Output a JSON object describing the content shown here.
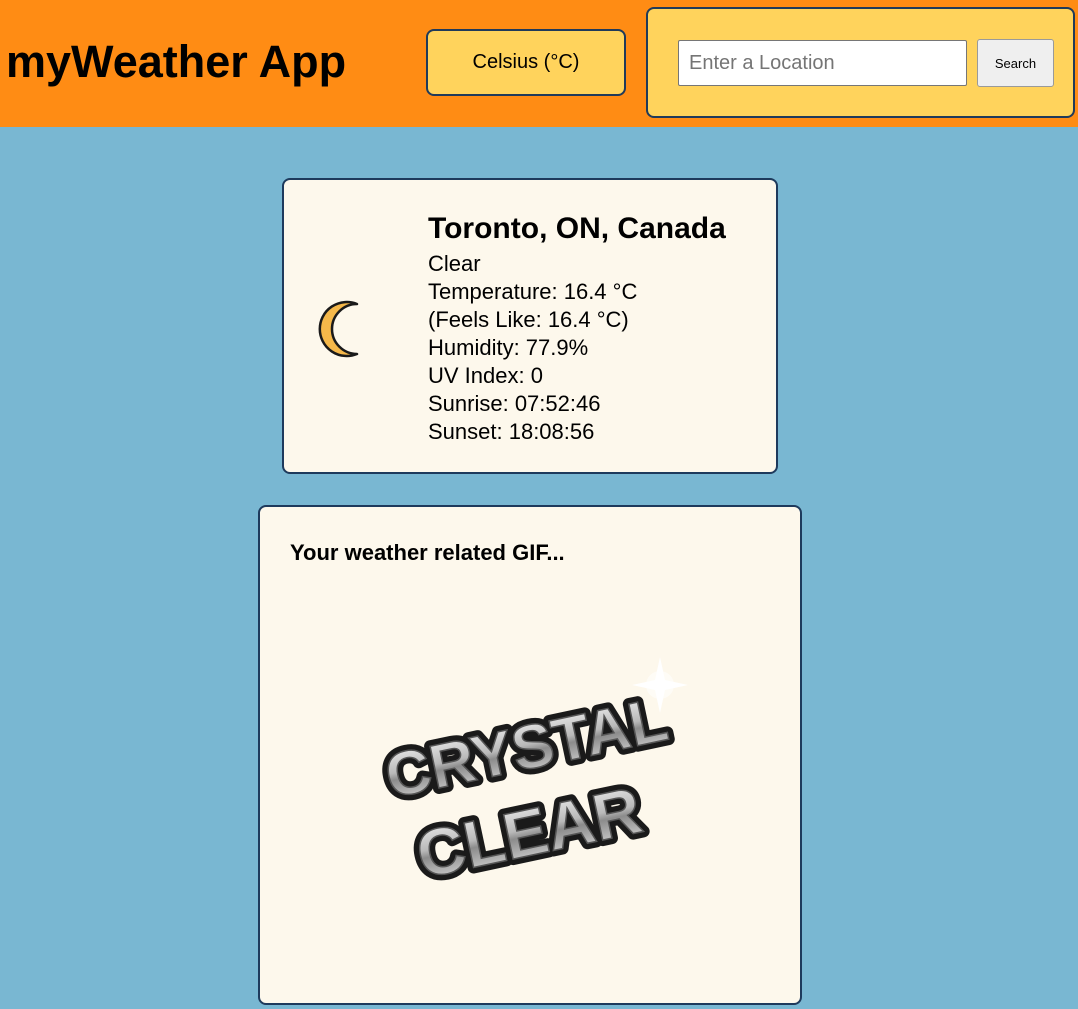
{
  "header": {
    "app_title": "myWeather App",
    "unit_toggle_label": "Celsius (°C)",
    "search": {
      "placeholder": "Enter a Location",
      "value": "",
      "button_label": "Search"
    }
  },
  "weather": {
    "icon": "moon-icon",
    "location": "Toronto, ON, Canada",
    "condition": "Clear",
    "temperature": "Temperature: 16.4 °C",
    "feels_like": "(Feels Like: 16.4 °C)",
    "humidity": "Humidity: 77.9%",
    "uv_index": "UV Index: 0",
    "sunrise": "Sunrise: 07:52:46",
    "sunset": "Sunset: 18:08:56"
  },
  "gif_section": {
    "heading": "Your weather related GIF...",
    "gif_text_line1": "CRYSTAL",
    "gif_text_line2": "CLEAR"
  },
  "colors": {
    "header_bg": "#ff8c14",
    "panel_bg": "#ffd35c",
    "page_bg": "#79b7d2",
    "card_bg": "#fdf8ec",
    "border": "#1e3a5c",
    "moon": "#f5b84a"
  }
}
